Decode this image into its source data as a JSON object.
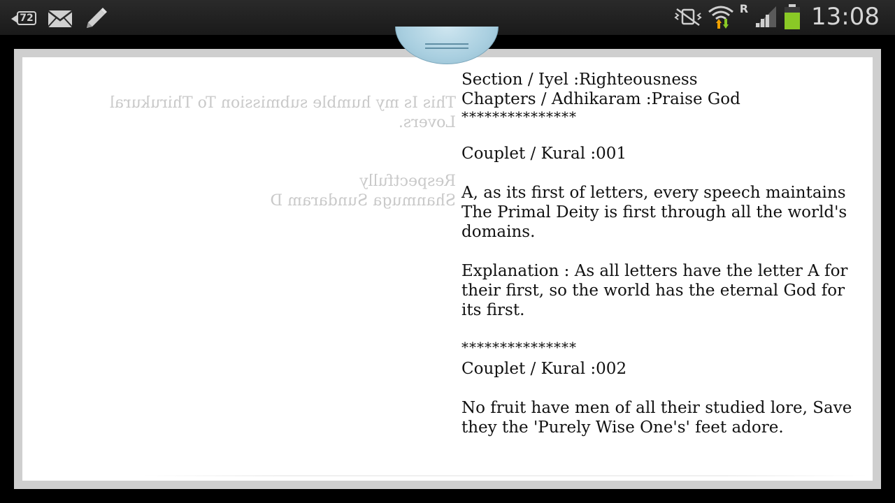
{
  "status_bar": {
    "notification_count": "72",
    "network_label": "R",
    "time": "13:08",
    "battery_color": "#8ac926"
  },
  "ghost_text": {
    "line1": "This Is my humble submission To Thirukural",
    "line2": "Lovers.",
    "line3": "Respectfully",
    "line4": "Shanmuga Sundaram D"
  },
  "book": {
    "section": "Section / Iyel :Righteousness",
    "chapter": "Chapters / Adhikaram :Praise God",
    "separator1": "***************",
    "couplet1_title": "Couplet / Kural :001",
    "couplet1_line1": "A, as its first of letters, every speech maintains",
    "couplet1_line2": "The Primal Deity is first through all the world's",
    "couplet1_line3": "domains.",
    "explanation_line1": "Explanation : As all letters have the letter A for",
    "explanation_line2": "their first, so the world has the eternal God for",
    "explanation_line3": "its first.",
    "separator2": "***************",
    "couplet2_title": "Couplet / Kural :002",
    "couplet2_line1": "No fruit have men of all their studied lore, Save",
    "couplet2_line2": "they the 'Purely Wise One's' feet adore."
  }
}
